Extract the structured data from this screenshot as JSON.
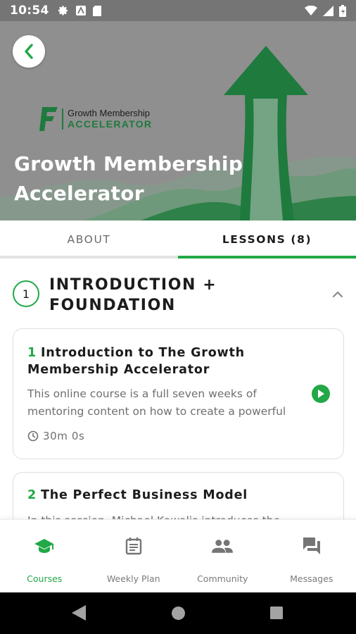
{
  "status_bar": {
    "time": "10:54",
    "left_icons": [
      "settings-icon",
      "android-auto-icon",
      "sd-card-icon"
    ],
    "right_icons": [
      "wifi-icon",
      "signal-icon",
      "battery-icon"
    ]
  },
  "hero": {
    "brand_name_top": "Growth Membership",
    "brand_name_bottom": "ACCELERATOR",
    "title": "Growth Membership Accelerator",
    "colors": {
      "accent": "#1f7a3e",
      "background": "#8f8f8f"
    }
  },
  "tabs": [
    {
      "label": "ABOUT",
      "active": false
    },
    {
      "label": "LESSONS (8)",
      "active": true
    }
  ],
  "section": {
    "number": "1",
    "title": "INTRODUCTION + FOUNDATION",
    "expanded": true
  },
  "lessons": [
    {
      "number": "1",
      "title": "Introduction to The Growth Membership Accelerator",
      "description": "This online course is a full seven weeks of mentoring content on how to create a powerful",
      "duration": "30m 0s"
    },
    {
      "number": "2",
      "title": "The Perfect Business Model",
      "description": "In this session, Michael Kawalis introduces the"
    }
  ],
  "bottom_nav": [
    {
      "label": "Courses",
      "icon": "graduation-cap-icon",
      "active": true
    },
    {
      "label": "Weekly Plan",
      "icon": "calendar-icon",
      "active": false
    },
    {
      "label": "Community",
      "icon": "people-icon",
      "active": false
    },
    {
      "label": "Messages",
      "icon": "chat-icon",
      "active": false
    }
  ],
  "colors": {
    "primary": "#22a846",
    "text": "#1c1c1c",
    "muted": "#6f6f6f"
  }
}
